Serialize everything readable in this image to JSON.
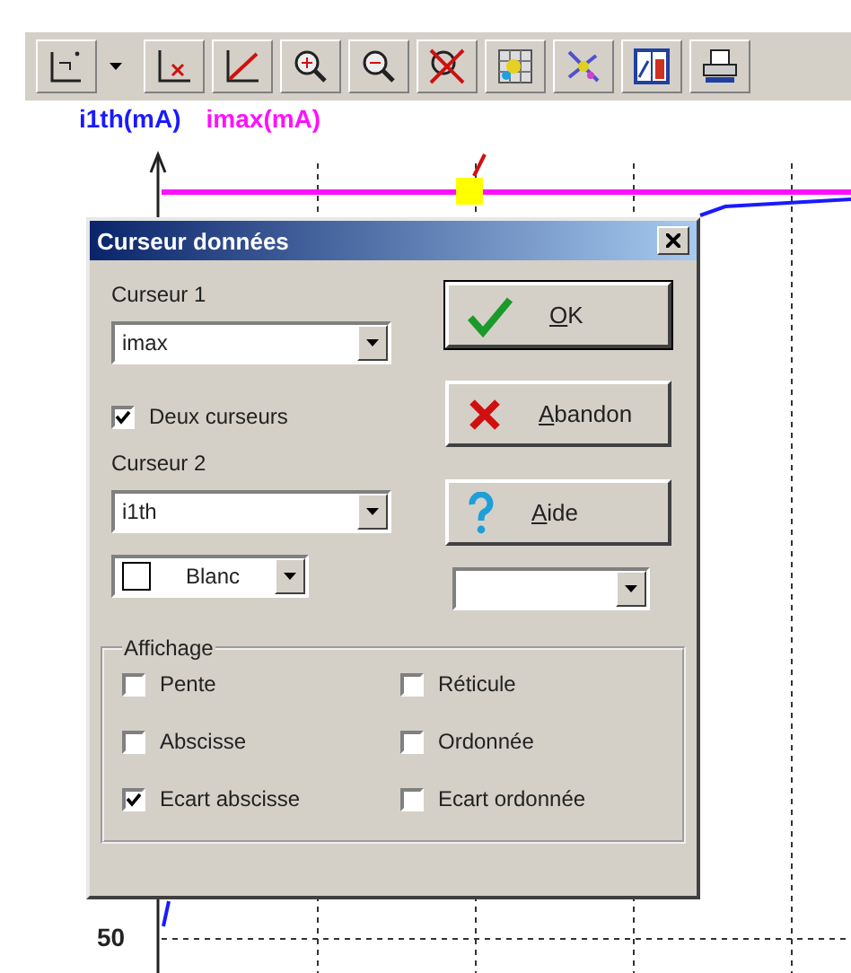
{
  "plot": {
    "legend": [
      {
        "label": "i1th(mA)",
        "color": "#1a1aff"
      },
      {
        "label": "imax(mA)",
        "color": "#ff10ff"
      }
    ],
    "y_tick": "50"
  },
  "dialog": {
    "title": "Curseur données",
    "cursor_1": {
      "label": "Curseur 1",
      "value": "imax"
    },
    "two_cursors": {
      "label": "Deux curseurs",
      "checked": true
    },
    "cursor_2": {
      "label": "Curseur 2",
      "value": "i1th"
    },
    "color_select": {
      "value": "Blanc"
    },
    "buttons": [
      {
        "kind": "ok",
        "label": "OK"
      },
      {
        "kind": "cancel",
        "label": "Abandon"
      },
      {
        "kind": "help",
        "label": "Aide"
      }
    ],
    "display_group": {
      "title": "Affichage",
      "options": [
        {
          "label": "Pente",
          "checked": false
        },
        {
          "label": "Réticule",
          "checked": false
        },
        {
          "label": "Abscisse",
          "checked": false
        },
        {
          "label": "Ordonnée",
          "checked": false
        },
        {
          "label": "Ecart abscisse",
          "checked": true
        },
        {
          "label": "Ecart ordonnée",
          "checked": false
        }
      ]
    }
  }
}
